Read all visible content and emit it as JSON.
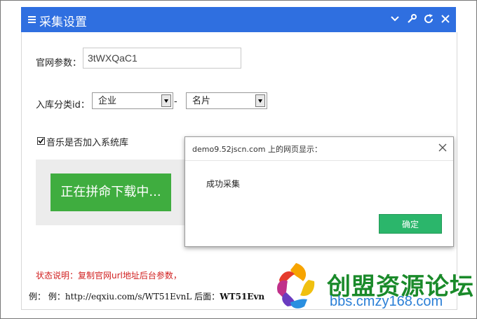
{
  "window": {
    "title": "采集设置"
  },
  "form": {
    "param_label": "官网参数：",
    "param_value": "3tWXQaC1",
    "category_label": "入库分类id：",
    "category_primary": "企业",
    "category_separator": "-",
    "category_secondary": "名片",
    "music_label": "音乐是否加入系统库",
    "music_checked": true
  },
  "download": {
    "button_label": "正在拼命下载中..."
  },
  "status": {
    "text": "状态说明：复制官网url地址后台参数，"
  },
  "example": {
    "prefix": "例：",
    "text": "例：http://eqxiu.com/s/WT51EvnL 后面：",
    "bold": "WT51Evn"
  },
  "dialog": {
    "title": "demo9.52jscn.com 上的网页显示：",
    "message": "成功采集",
    "ok_label": "确定"
  },
  "watermark": {
    "name": "创盟资源论坛",
    "url": "bbs.cmzy168.com"
  },
  "colors": {
    "titlebar": "#2f6fe0",
    "download_button": "#3fad3f",
    "ok_button": "#2bb66b",
    "status_text": "#d12020"
  }
}
